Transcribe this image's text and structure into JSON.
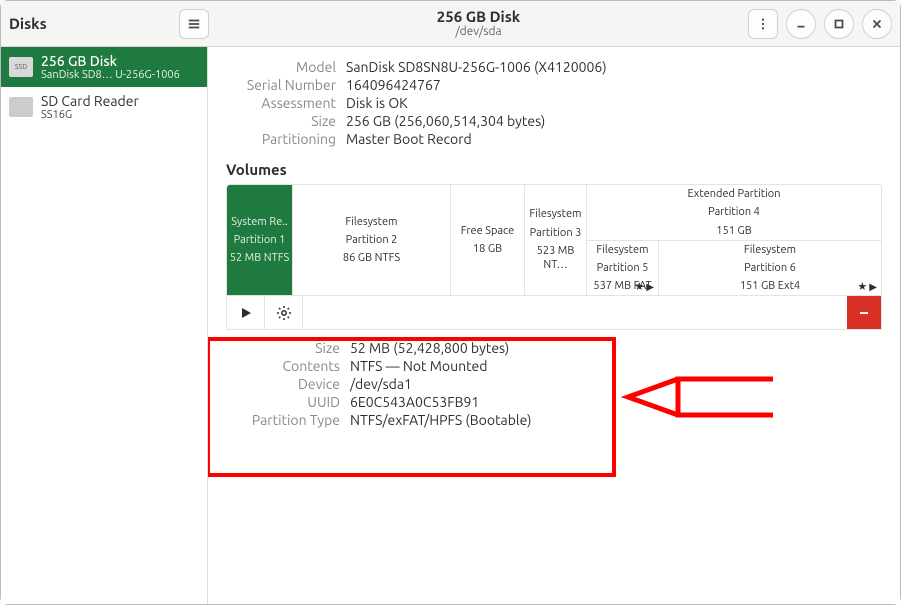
{
  "header": {
    "app_title": "Disks",
    "title": "256 GB Disk",
    "subtitle": "/dev/sda"
  },
  "sidebar": {
    "items": [
      {
        "line1": "256 GB Disk",
        "line2": "SanDisk SD8…   U-256G-1006",
        "thumb": "SSD"
      },
      {
        "line1": "SD Card Reader",
        "line2": "SS16G",
        "thumb": ""
      }
    ]
  },
  "disk_info": {
    "labels": {
      "model": "Model",
      "serial": "Serial Number",
      "assessment": "Assessment",
      "size": "Size",
      "partitioning": "Partitioning"
    },
    "model": "SanDisk SD8SN8U-256G-1006 (X4120006)",
    "serial": "164096424767",
    "assessment": "Disk is OK",
    "size": "256 GB (256,060,514,304 bytes)",
    "partitioning": "Master Boot Record"
  },
  "volumes_header": "Volumes",
  "volumes": {
    "p1": {
      "l1": "System Re..",
      "l2": "Partition 1",
      "l3": "52 MB NTFS"
    },
    "p2": {
      "l1": "Filesystem",
      "l2": "Partition 2",
      "l3": "86 GB NTFS"
    },
    "free": {
      "l1": "Free Space",
      "l2": "18 GB"
    },
    "p3": {
      "l1": "Filesystem",
      "l2": "Partition 3",
      "l3": "523 MB NT…"
    },
    "p4": {
      "l1": "Extended Partition",
      "l2": "Partition 4",
      "l3": "151 GB"
    },
    "p5": {
      "l1": "Filesystem",
      "l2": "Partition 5",
      "l3": "537 MB FAT"
    },
    "p6": {
      "l1": "Filesystem",
      "l2": "Partition 6",
      "l3": "151 GB Ext4"
    }
  },
  "partition": {
    "labels": {
      "size": "Size",
      "contents": "Contents",
      "device": "Device",
      "uuid": "UUID",
      "ptype": "Partition Type"
    },
    "size": "52 MB (52,428,800 bytes)",
    "contents": "NTFS — Not Mounted",
    "device": "/dev/sda1",
    "uuid": "6E0C543A0C53FB91",
    "ptype": "NTFS/exFAT/HPFS (Bootable)"
  }
}
